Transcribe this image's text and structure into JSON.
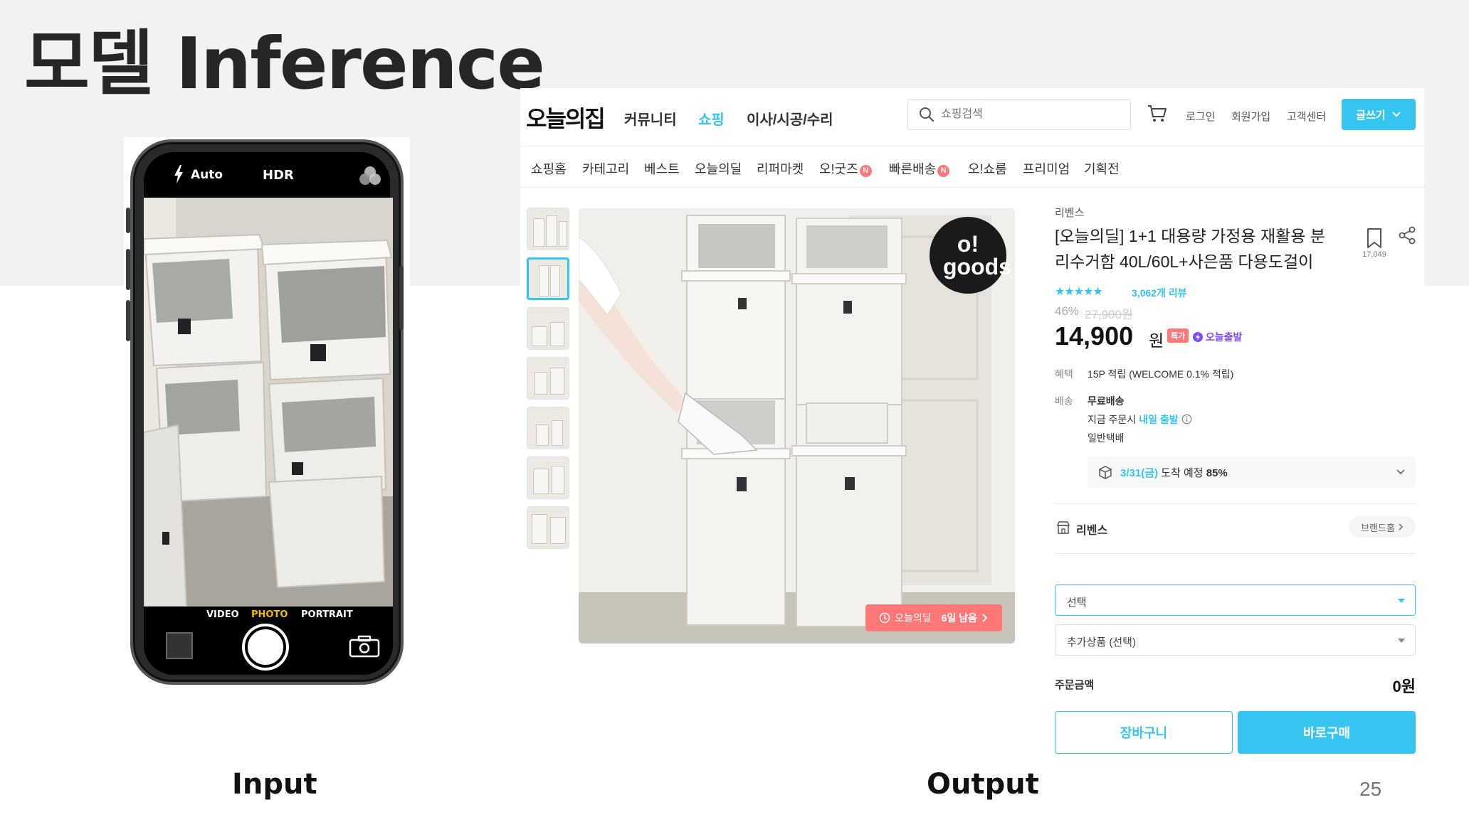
{
  "slide": {
    "title": "모델 Inference",
    "input_label": "Input",
    "output_label": "Output",
    "page_number": "25"
  },
  "camera": {
    "flash_mode": "Auto",
    "hdr": "HDR",
    "modes": [
      "VIDEO",
      "PHOTO",
      "PORTRAIT"
    ],
    "active_mode": "PHOTO",
    "icons": [
      "flash-icon",
      "filter-icon",
      "shutter-button",
      "camera-flip-icon"
    ]
  },
  "shop": {
    "logo": "오늘의집",
    "nav": [
      "커뮤니티",
      "쇼핑",
      "이사/시공/수리"
    ],
    "active_nav": "쇼핑",
    "search_placeholder": "쇼핑검색",
    "util": [
      "로그인",
      "회원가입",
      "고객센터"
    ],
    "write_label": "글쓰기",
    "categories": [
      "쇼핑홈",
      "카테고리",
      "베스트",
      "오늘의딜",
      "리퍼마켓",
      "오!굿즈",
      "빠른배송",
      "오!쇼룸",
      "프리미엄",
      "기획전"
    ],
    "new_badge": "N",
    "accent_color": "#35c5f0"
  },
  "product": {
    "brand": "리벤스",
    "title": "[오늘의딜] 1+1 대용량 가정용 재활용 분리수거함 40L/60L+사은품 다용도걸이",
    "bookmark_count": "17,049",
    "stars": "★★★★★",
    "reviews": "3,062개 리뷰",
    "discount": "46%",
    "original_price": "27,900원",
    "price": "14,900",
    "currency": "원",
    "special_badge": "특가",
    "today_departure": "오늘출발",
    "benefit_label": "혜택",
    "benefit_value": "15P 적립 (WELCOME 0.1% 적립)",
    "shipping_label": "배송",
    "shipping_free": "무료배송",
    "shipping_order_now": "지금 주문시",
    "shipping_tomorrow": "내일 출발",
    "shipping_type": "일반택배",
    "arrival_date": "3/31(금)",
    "arrival_text": "도착 예정",
    "arrival_rate": "85%",
    "brand_shop_name": "리벤스",
    "brand_home_label": "브랜드홈",
    "option_select": "선택",
    "extra_select": "추가상품 (선택)",
    "order_amount_label": "주문금액",
    "order_amount": "0원",
    "cart_button": "장바구니",
    "buy_button": "바로구매",
    "image_badge": "o! goods",
    "deal_label": "오늘의딜",
    "deal_remaining": "6일 남음"
  }
}
